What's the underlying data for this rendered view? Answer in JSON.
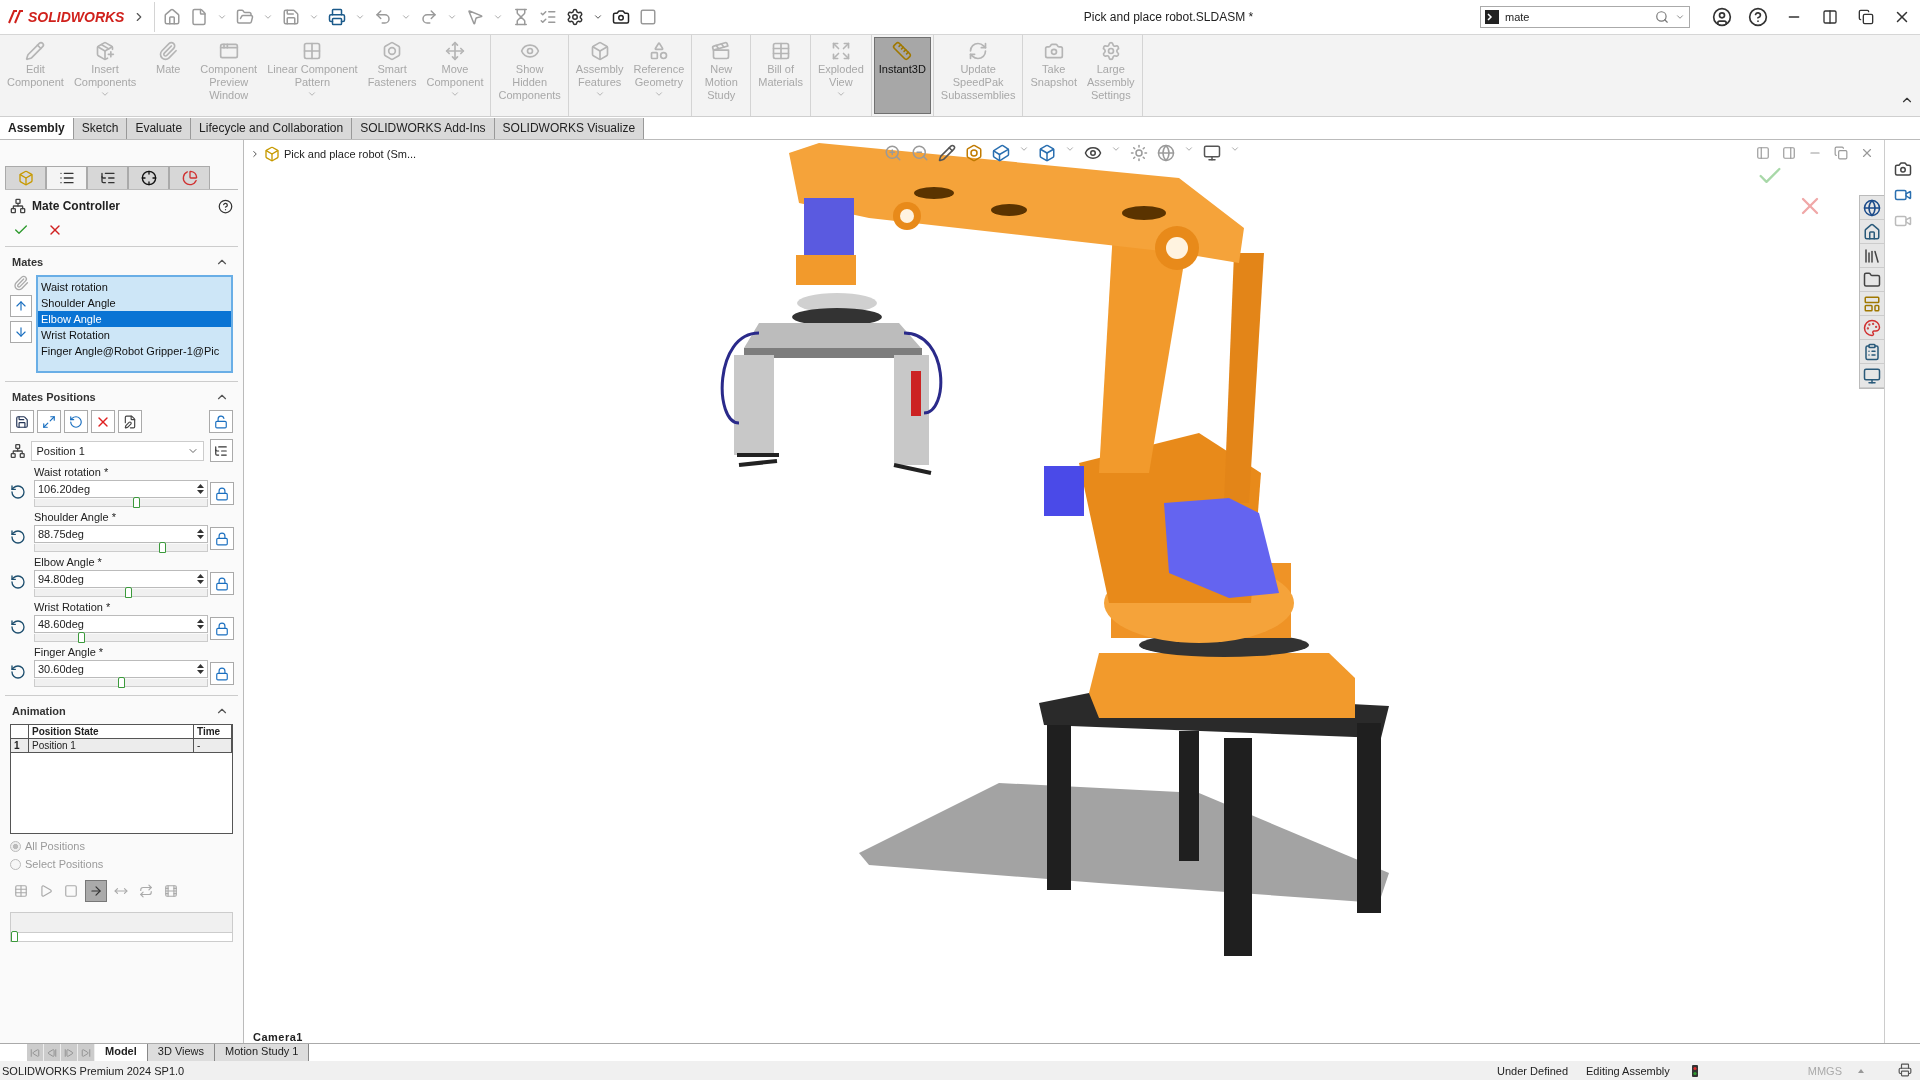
{
  "title_bar": {
    "logo": "SOLIDWORKS",
    "document_title": "Pick and place robot.SLDASM *",
    "search": {
      "value": "mate"
    }
  },
  "ribbon": {
    "groups": [
      [
        {
          "kind": "edit",
          "label": "Edit\nComponent",
          "dropdown": false,
          "disabled": true,
          "selected": false
        },
        {
          "kind": "insert",
          "label": "Insert\nComponents",
          "dropdown": true,
          "disabled": true,
          "selected": false
        },
        {
          "kind": "mate",
          "label": "Mate",
          "dropdown": false,
          "disabled": true,
          "selected": false
        },
        {
          "kind": "preview",
          "label": "Component\nPreview\nWindow",
          "dropdown": false,
          "disabled": true,
          "selected": false
        },
        {
          "kind": "pattern",
          "label": "Linear Component\nPattern",
          "dropdown": true,
          "disabled": true,
          "selected": false
        },
        {
          "kind": "fastener",
          "label": "Smart\nFasteners",
          "dropdown": false,
          "disabled": true,
          "selected": false
        },
        {
          "kind": "move",
          "label": "Move\nComponent",
          "dropdown": true,
          "disabled": true,
          "selected": false
        }
      ],
      [
        {
          "kind": "show",
          "label": "Show\nHidden\nComponents",
          "dropdown": false,
          "disabled": true,
          "selected": false
        }
      ],
      [
        {
          "kind": "features",
          "label": "Assembly\nFeatures",
          "dropdown": true,
          "disabled": true,
          "selected": false
        },
        {
          "kind": "geometry",
          "label": "Reference\nGeometry",
          "dropdown": true,
          "disabled": true,
          "selected": false
        }
      ],
      [
        {
          "kind": "motion",
          "label": "New\nMotion\nStudy",
          "dropdown": false,
          "disabled": true,
          "selected": false
        }
      ],
      [
        {
          "kind": "bom",
          "label": "Bill of\nMaterials",
          "dropdown": false,
          "disabled": true,
          "selected": false
        }
      ],
      [
        {
          "kind": "exploded",
          "label": "Exploded\nView",
          "dropdown": true,
          "disabled": true,
          "selected": false
        }
      ],
      [
        {
          "kind": "instant3d",
          "label": "Instant3D",
          "dropdown": false,
          "disabled": false,
          "selected": true
        }
      ],
      [
        {
          "kind": "speedpak",
          "label": "Update\nSpeedPak\nSubassemblies",
          "dropdown": false,
          "disabled": true,
          "selected": false
        }
      ],
      [
        {
          "kind": "snapshot",
          "label": "Take\nSnapshot",
          "dropdown": false,
          "disabled": true,
          "selected": false
        },
        {
          "kind": "settings",
          "label": "Large\nAssembly\nSettings",
          "dropdown": false,
          "disabled": true,
          "selected": false
        }
      ]
    ]
  },
  "command_tabs": [
    {
      "label": "Assembly",
      "selected": true
    },
    {
      "label": "Sketch",
      "selected": false
    },
    {
      "label": "Evaluate",
      "selected": false
    },
    {
      "label": "Lifecycle and Collaboration",
      "selected": false
    },
    {
      "label": "SOLIDWORKS Add-Ins",
      "selected": false
    },
    {
      "label": "SOLIDWORKS Visualize",
      "selected": false
    }
  ],
  "panel_tabs": [
    {
      "kind": "features",
      "selected": false
    },
    {
      "kind": "property",
      "selected": true
    },
    {
      "kind": "config",
      "selected": false
    },
    {
      "kind": "dimxpert",
      "selected": false
    },
    {
      "kind": "display",
      "selected": false
    }
  ],
  "property_manager": {
    "title": "Mate Controller",
    "mates": {
      "header": "Mates",
      "items": [
        {
          "label": "Waist rotation",
          "selected": false
        },
        {
          "label": "Shoulder Angle",
          "selected": false
        },
        {
          "label": "Elbow Angle",
          "selected": true
        },
        {
          "label": "Wrist Rotation",
          "selected": false
        },
        {
          "label": "Finger Angle@Robot Gripper-1@Pic",
          "selected": false
        }
      ]
    },
    "positions": {
      "header": "Mates Positions",
      "position": "Position 1",
      "fields": [
        {
          "label": "Waist rotation *",
          "value": "106.20deg",
          "level": 0.585
        },
        {
          "label": "Shoulder Angle *",
          "value": "88.75deg",
          "level": 0.74
        },
        {
          "label": "Elbow Angle *",
          "value": "94.80deg",
          "level": 0.54
        },
        {
          "label": "Wrist Rotation *",
          "value": "48.60deg",
          "level": 0.27
        },
        {
          "label": "Finger Angle *",
          "value": "30.60deg",
          "level": 0.5
        }
      ]
    },
    "animation": {
      "header": "Animation",
      "columns": [
        "Position State",
        "Time"
      ],
      "rows": [
        {
          "index": "1",
          "state": "Position 1",
          "time": "-"
        }
      ],
      "options": [
        {
          "label": "All Positions",
          "selected": true
        },
        {
          "label": "Select Positions",
          "selected": false
        }
      ],
      "controls": [
        {
          "kind": "table",
          "selected": false
        },
        {
          "kind": "play",
          "selected": false
        },
        {
          "kind": "stop",
          "selected": false
        },
        {
          "kind": "normal",
          "selected": true
        },
        {
          "kind": "reciprocate",
          "selected": false
        },
        {
          "kind": "loop",
          "selected": false
        },
        {
          "kind": "save",
          "selected": false
        }
      ],
      "timeline": {
        "level": 0
      }
    }
  },
  "viewport": {
    "tree_item": "Pick and place robot (Sm...",
    "camera_label": "Camera1"
  },
  "bottom_tabs": [
    {
      "label": "Model",
      "selected": true
    },
    {
      "label": "3D Views",
      "selected": false
    },
    {
      "label": "Motion Study 1",
      "selected": false
    }
  ],
  "status_bar": {
    "product": "SOLIDWORKS Premium 2024 SP1.0",
    "state": "Under Defined",
    "mode": "Editing Assembly",
    "units": "MMGS"
  }
}
